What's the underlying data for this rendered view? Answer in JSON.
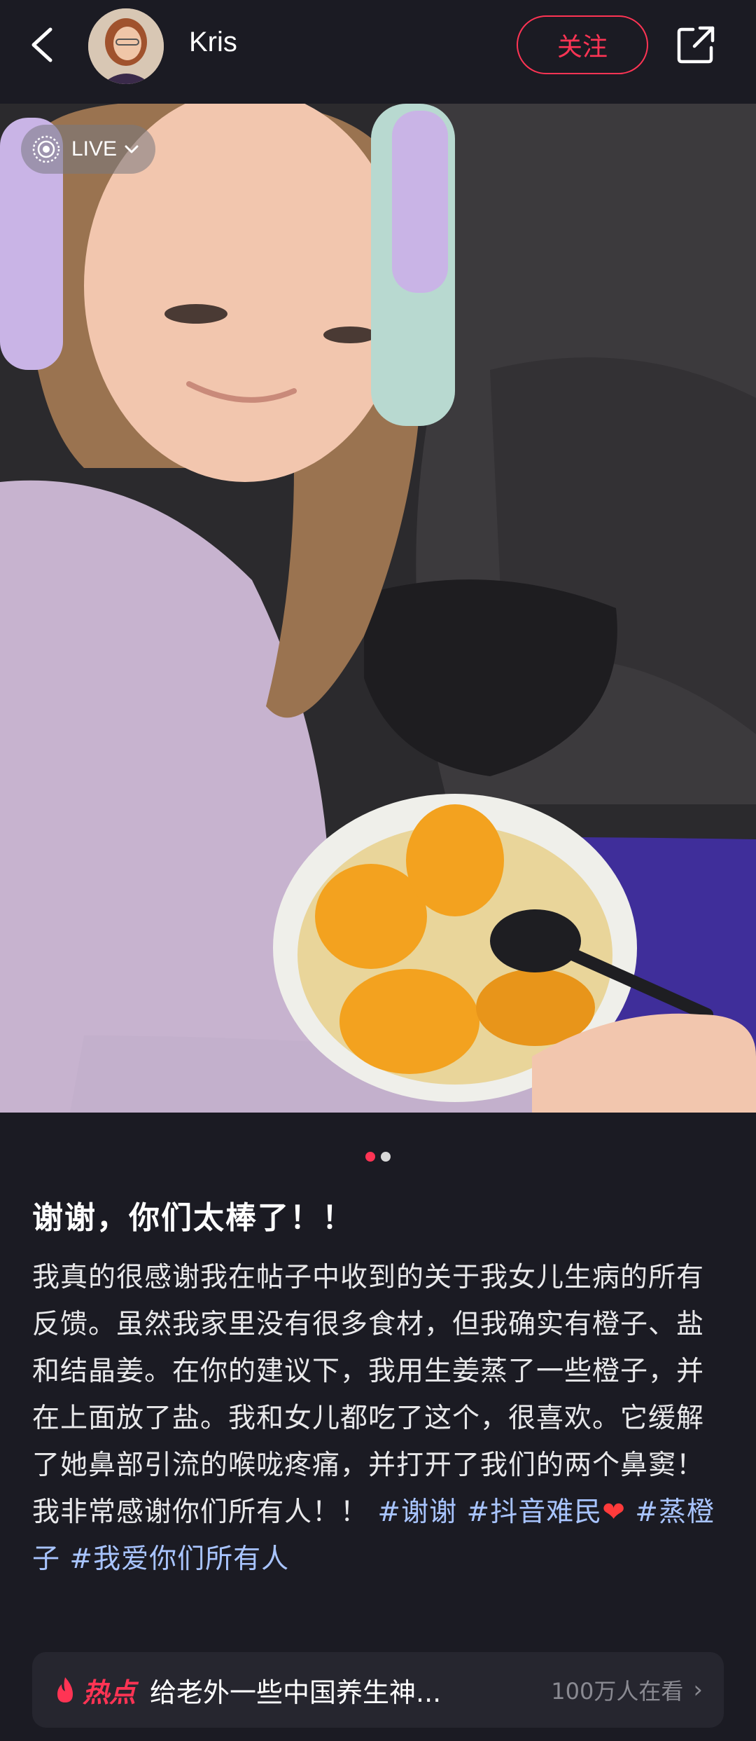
{
  "header": {
    "username": "Kris",
    "follow_label": "关注"
  },
  "photo": {
    "live_label": "LIVE",
    "page_count": 2,
    "current_page": 1
  },
  "post": {
    "title": "谢谢，你们太棒了！！",
    "body_text": "我真的很感谢我在帖子中收到的关于我女儿生病的所有反馈。虽然我家里没有很多食材，但我确实有橙子、盐和结晶姜。在你的建议下，我用生姜蒸了一些橙子，并在上面放了盐。我和女儿都吃了这个，很喜欢。它缓解了她鼻部引流的喉咙疼痛，并打开了我们的两个鼻窦！我非常感谢你们所有人！！",
    "hashtags": [
      "#谢谢",
      "#抖音难民",
      "#蒸橙子",
      "#我爱你们所有人"
    ]
  },
  "hot": {
    "label": "热点",
    "title": "给老外一些中国养生神...",
    "viewers": "100万人在看"
  },
  "colors": {
    "accent": "#ff3454",
    "hashtag": "#a8c4ff",
    "background": "#1b1b23"
  }
}
